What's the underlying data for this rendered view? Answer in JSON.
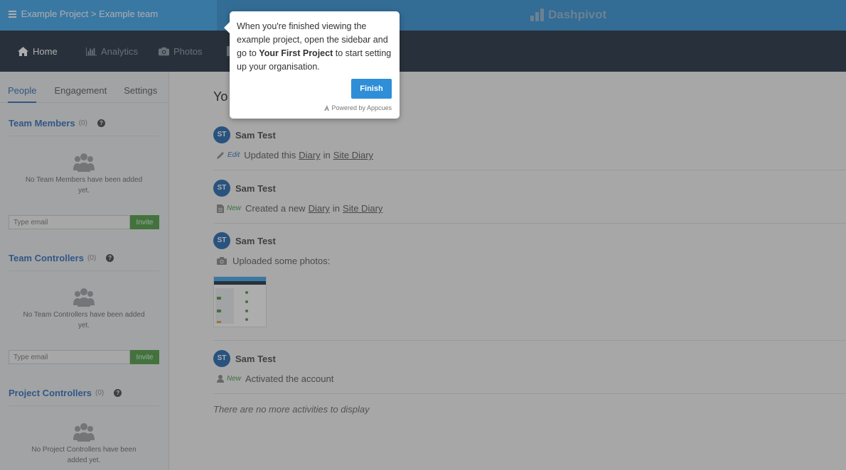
{
  "header": {
    "breadcrumb": "Example Project > Example team",
    "brand": "Dashpivot"
  },
  "nav": {
    "items": [
      {
        "label": "Home",
        "icon": "home-icon"
      },
      {
        "label": "Analytics",
        "icon": "bar-chart-icon"
      },
      {
        "label": "Photos",
        "icon": "camera-icon"
      }
    ]
  },
  "sidebar": {
    "tabs": [
      "People",
      "Engagement",
      "Settings"
    ],
    "sections": [
      {
        "title": "Team Members",
        "count": "(0)",
        "empty": "No Team Members have been added yet.",
        "placeholder": "Type email",
        "button": "Invite"
      },
      {
        "title": "Team Controllers",
        "count": "(0)",
        "empty": "No Team Controllers have been added yet.",
        "placeholder": "Type email",
        "button": "Invite"
      },
      {
        "title": "Project Controllers",
        "count": "(0)",
        "empty": "No Project Controllers have been added yet."
      }
    ]
  },
  "main": {
    "heading": "Yo",
    "activities": [
      {
        "initials": "ST",
        "user": "Sam Test",
        "tag": "Edit",
        "pre": "Updated this",
        "link1": "Diary",
        "mid": "in",
        "link2": "Site Diary"
      },
      {
        "initials": "ST",
        "user": "Sam Test",
        "tag": "New",
        "pre": "Created a new",
        "link1": "Diary",
        "mid": "in",
        "link2": "Site Diary"
      },
      {
        "initials": "ST",
        "user": "Sam Test",
        "text": "Uploaded some photos:"
      },
      {
        "initials": "ST",
        "user": "Sam Test",
        "tag": "New",
        "text": "Activated the account"
      }
    ],
    "no_more": "There are no more activities to display"
  },
  "tooltip": {
    "text_a": "When you're finished viewing the example project, open the sidebar and go to ",
    "text_bold": "Your First Project",
    "text_b": " to start setting up your organisation.",
    "button": "Finish",
    "powered": "Powered by Appcues"
  },
  "colors": {
    "accent": "#2d8fd6",
    "nav": "#1a2a3c",
    "link": "#2a6bbd",
    "invite": "#4a9a3e"
  }
}
